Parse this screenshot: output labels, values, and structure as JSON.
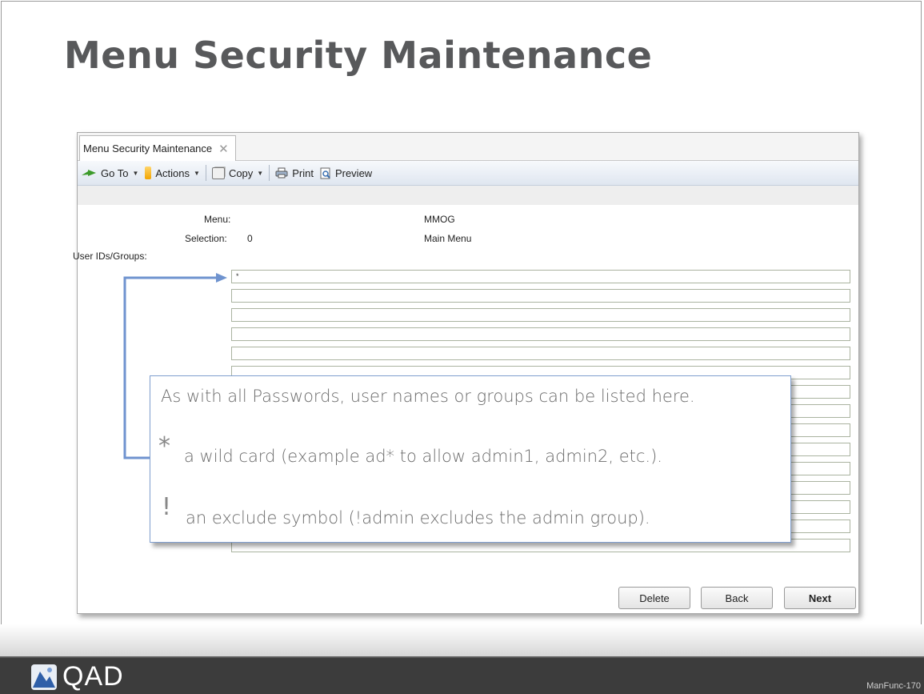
{
  "slide": {
    "title": "Menu Security Maintenance",
    "footer_code": "ManFunc-170",
    "logo_text": "QAD"
  },
  "window": {
    "tab_label": "Menu Security Maintenance",
    "toolbar": {
      "goto_label": "Go To",
      "actions_label": "Actions",
      "copy_label": "Copy",
      "print_label": "Print",
      "preview_label": "Preview"
    },
    "form": {
      "menu_label": "Menu:",
      "menu_value": "MMOG",
      "selection_label": "Selection:",
      "selection_value": "0",
      "selection_desc": "Main Menu",
      "userids_label": "User IDs/Groups:"
    },
    "user_ids": [
      "*",
      "",
      "",
      "",
      "",
      "",
      "",
      "",
      "",
      "",
      "",
      "",
      "",
      "",
      ""
    ],
    "buttons": {
      "delete_label": "Delete",
      "back_label": "Back",
      "next_label": "Next"
    }
  },
  "callout": {
    "line1": "As with all Passwords,  user names or groups can be listed here.",
    "wildcard_symbol": "*",
    "line2": "a wild card (example ad* to allow admin1, admin2, etc.).",
    "exclude_symbol": "!",
    "line3": "an exclude symbol (!admin excludes the admin group)."
  },
  "colors": {
    "title": "#58595b",
    "callout_border": "#7f9fcf",
    "arrow": "#6f93cf",
    "footer_bg": "#3c3c3c"
  }
}
